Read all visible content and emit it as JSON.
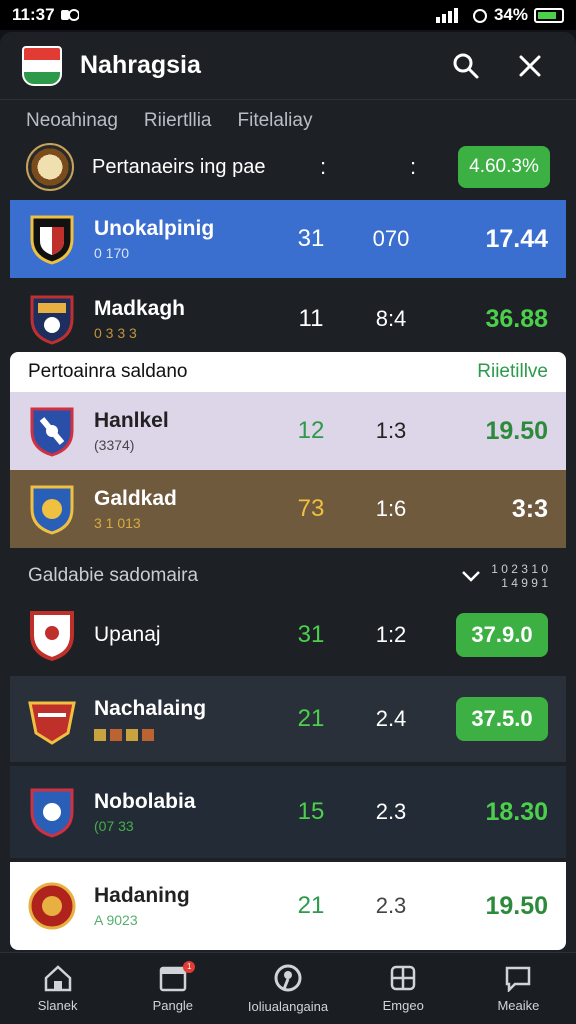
{
  "status_bar": {
    "time": "11:37",
    "right": "34%"
  },
  "header": {
    "title": "Nahragsia"
  },
  "filters": [
    "Neoahinag",
    "Riiertllia",
    "Fitelaliay"
  ],
  "summary": {
    "label": "Pertanaeirs ing pae",
    "dot1": ":",
    "dot2": ":",
    "value": "4.60.3%"
  },
  "section1": {
    "rows": [
      {
        "name": "Unokalpinig",
        "sub": "0 170",
        "c1": "31",
        "c2": "070",
        "c3": "17.44"
      },
      {
        "name": "Madkagh",
        "sub": "0 3 3 3",
        "c1": "11",
        "c2": "8:4",
        "c3": "36.88"
      }
    ]
  },
  "section2": {
    "title": "Pertoainra saldano",
    "action": "Riietillve",
    "rows": [
      {
        "name": "Hanlkel",
        "sub": "(3374)",
        "c1": "12",
        "c2": "1:3",
        "c3": "19.50"
      },
      {
        "name": "Galdkad",
        "sub": "3 1 013",
        "c1": "73",
        "c2": "1:6",
        "c3": "3:3"
      }
    ]
  },
  "section3": {
    "title": "Galdabie sadomaira",
    "meta1": "1 0 2 3 1 0",
    "meta2": "1 4 9 9 1",
    "rows": [
      {
        "name": "Upanaj",
        "sub": "",
        "c1": "31",
        "c2": "1:2",
        "c3": "37.9.0"
      },
      {
        "name": "Nachalaing",
        "sub": "",
        "c1": "21",
        "c2": "2.4",
        "c3": "37.5.0"
      },
      {
        "name": "Nobolabia",
        "sub": "(07 33",
        "c1": "15",
        "c2": "2.3",
        "c3": "18.30"
      },
      {
        "name": "Hadaning",
        "sub": "A 9023",
        "c1": "21",
        "c2": "2.3",
        "c3": "19.50"
      }
    ]
  },
  "nav": [
    {
      "label": "Slanek",
      "icon": "home-icon"
    },
    {
      "label": "Pangle",
      "icon": "calendar-icon",
      "badge": "1"
    },
    {
      "label": "Ioliualangaina",
      "icon": "ball-icon"
    },
    {
      "label": "Emgeo",
      "icon": "grid-icon"
    },
    {
      "label": "Meaike",
      "icon": "chat-icon"
    }
  ],
  "colors": {
    "accent_blue": "#3a6fcf",
    "accent_green": "#3cb043",
    "lavender": "#ddd5e8",
    "brown": "#6f5a3e"
  }
}
